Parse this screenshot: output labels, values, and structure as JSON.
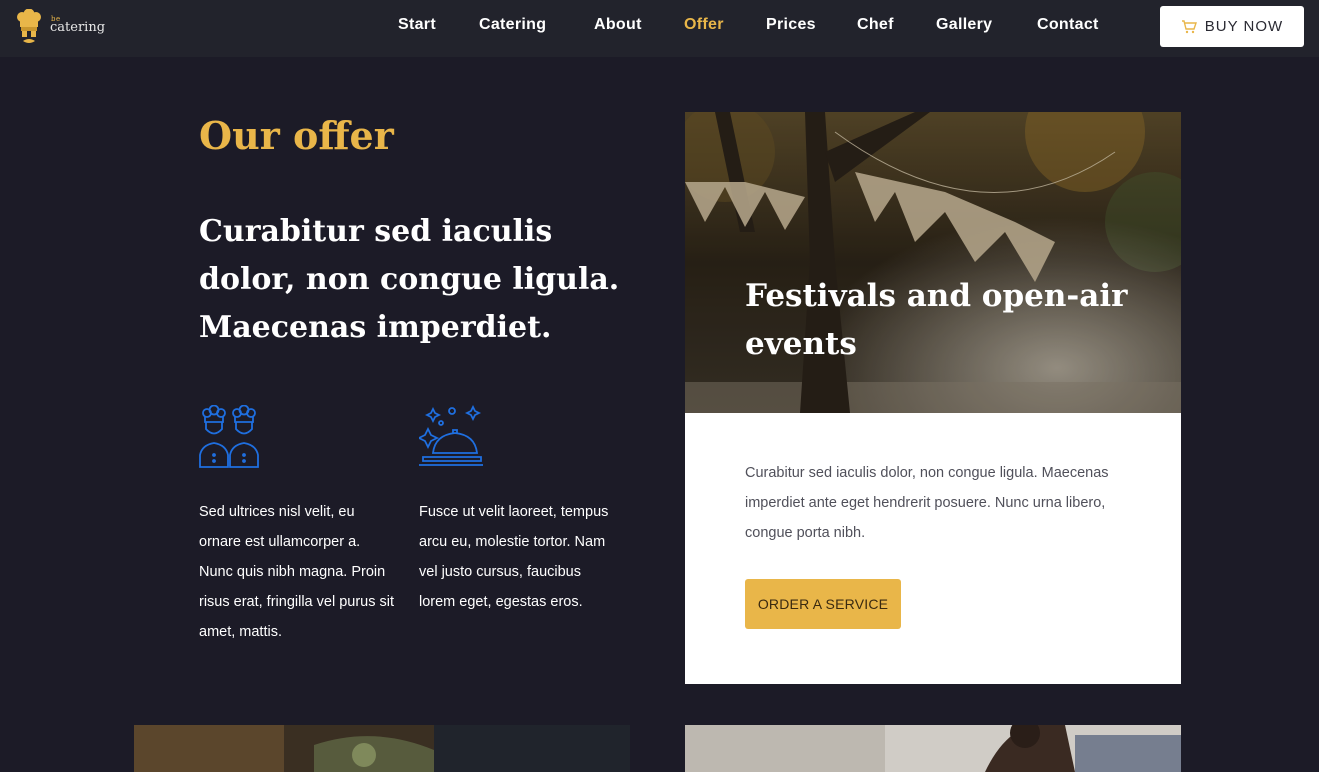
{
  "header": {
    "logo_small": "be",
    "logo_big": "catering",
    "nav": [
      {
        "label": "Start",
        "active": false
      },
      {
        "label": "Catering",
        "active": false
      },
      {
        "label": "About",
        "active": false
      },
      {
        "label": "Offer",
        "active": true
      },
      {
        "label": "Prices",
        "active": false
      },
      {
        "label": "Chef",
        "active": false
      },
      {
        "label": "Gallery",
        "active": false
      },
      {
        "label": "Contact",
        "active": false
      }
    ],
    "buy_label": "BUY NOW",
    "buy_icon": "cart-icon"
  },
  "offer": {
    "title": "Our offer",
    "lead": "Curabitur sed iaculis dolor, non congue ligula. Maecenas imperdiet.",
    "features": [
      {
        "icon": "chefs-icon",
        "text": "Sed ultrices nisl velit, eu ornare est ullamcorper a. Nunc quis nibh magna. Proin risus erat, fringilla vel purus sit amet, mattis."
      },
      {
        "icon": "cloche-icon",
        "text": "Fusce ut velit laoreet, tempus arcu eu, molestie tortor. Nam vel justo cursus, faucibus lorem eget, egestas eros."
      }
    ]
  },
  "card": {
    "title": "Festivals and open-air events",
    "text": "Curabitur sed iaculis dolor, non congue ligula. Maecenas imperdiet ante eget hendrerit posuere. Nunc urna libero, congue porta nibh.",
    "button": "ORDER A SERVICE"
  },
  "colors": {
    "accent": "#e9b649",
    "background": "#1c1b27",
    "header": "#22232c",
    "icon_blue": "#1f6fe0"
  }
}
